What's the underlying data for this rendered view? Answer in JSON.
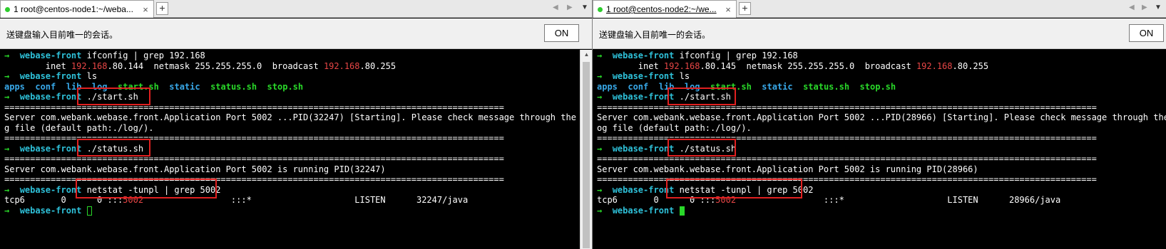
{
  "left": {
    "tab_title": "1 root@centos-node1:~/weba...",
    "broadcast_msg": "送键盘输入目前唯一的会话。",
    "on_button": "ON",
    "lines": {
      "l1_prompt": "webase-front",
      "l1_cmd": " ifconfig | grep 192.168",
      "l2_a": "        inet ",
      "l2_ip": "192.168",
      "l2_b": ".80.144  netmask 255.255.255.0  broadcast ",
      "l2_bc": "192.168",
      "l2_c": ".80.255",
      "l3_prompt": "webase-front",
      "l3_cmd": " ls",
      "ls_apps": "apps",
      "ls_conf": "conf",
      "ls_lib": "lib",
      "ls_log": "log",
      "ls_start": "start.sh",
      "ls_static": "static",
      "ls_status": "status.sh",
      "ls_stop": "stop.sh",
      "l5_prompt": "webase-front",
      "l5_cmd": " ./start.sh",
      "sep": "=================================================================================================",
      "start_msg1": "Server com.webank.webase.front.Application Port 5002 ...PID(32247) [Starting]. Please check message through the lo",
      "start_msg2": "g file (default path:./log/).",
      "l10_prompt": "webase-front",
      "l10_cmd": " ./status.sh",
      "status_msg": "Server com.webank.webase.front.Application Port 5002 is running PID(32247)",
      "l14_prompt": "webase-front",
      "l14_cmd": " netstat -tunpl | grep 5002",
      "ns_a": "tcp6       0      0 :::",
      "ns_port": "5002",
      "ns_b": "                 :::*                    LISTEN      32247/java",
      "last_prompt": "webase-front"
    }
  },
  "right": {
    "tab_title": "1 root@centos-node2:~/we...",
    "broadcast_msg": "送键盘输入目前唯一的会话。",
    "on_button": "ON",
    "lines": {
      "l1_prompt": "webase-front",
      "l1_cmd": " ifconfig | grep 192.168",
      "l2_a": "        inet ",
      "l2_ip": "192.168",
      "l2_b": ".80.145  netmask 255.255.255.0  broadcast ",
      "l2_bc": "192.168",
      "l2_c": ".80.255",
      "l3_prompt": "webase-front",
      "l3_cmd": " ls",
      "ls_apps": "apps",
      "ls_conf": "conf",
      "ls_lib": "lib",
      "ls_log": "log",
      "ls_start": "start.sh",
      "ls_static": "static",
      "ls_status": "status.sh",
      "ls_stop": "stop.sh",
      "l5_prompt": "webase-front",
      "l5_cmd": " ./start.sh",
      "sep": "=================================================================================================",
      "start_msg1": "Server com.webank.webase.front.Application Port 5002 ...PID(28966) [Starting]. Please check message through the l",
      "start_msg2": "og file (default path:./log/).",
      "l10_prompt": "webase-front",
      "l10_cmd": " ./status.sh",
      "status_msg": "Server com.webank.webase.front.Application Port 5002 is running PID(28966)",
      "l14_prompt": "webase-front",
      "l14_cmd": " netstat -tunpl | grep 5002",
      "ns_a": "tcp6       0      0 :::",
      "ns_port": "5002",
      "ns_b": "                 :::*                    LISTEN      28966/java",
      "last_prompt": "webase-front"
    }
  },
  "icons": {
    "arrow": "→",
    "close": "×",
    "add": "+",
    "nav_left": "◀",
    "nav_right": "▶",
    "menu": "▼"
  }
}
